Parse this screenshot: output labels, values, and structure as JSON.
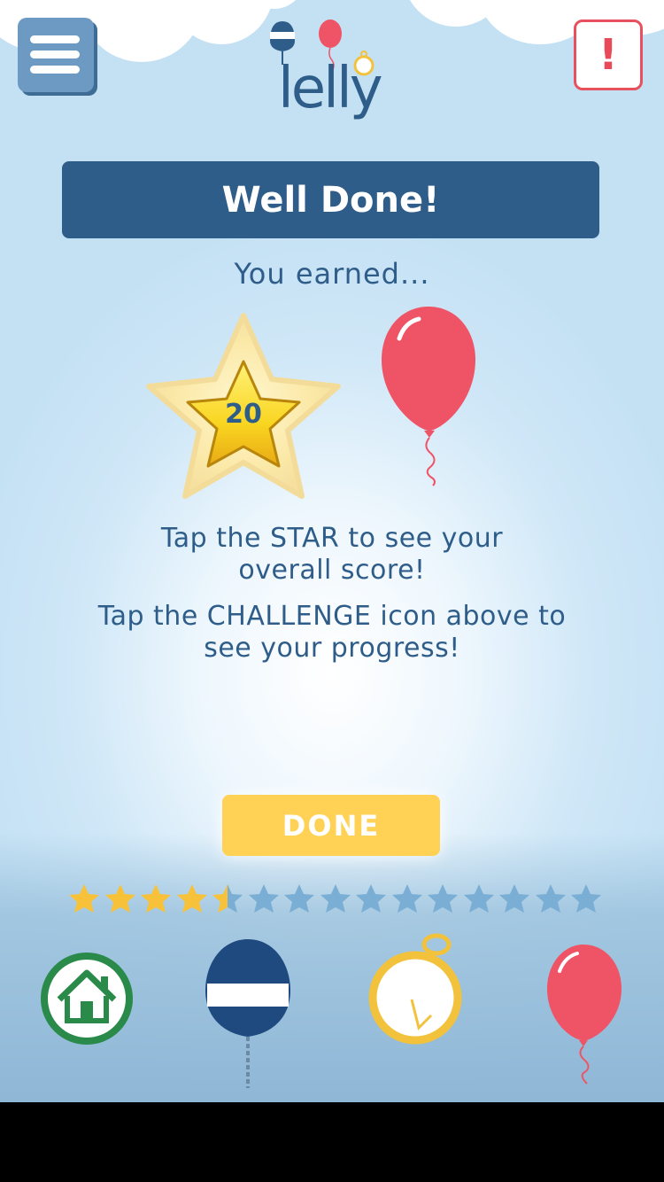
{
  "header": {
    "logo_text": "lelly",
    "menu_icon": "menu-icon",
    "alert_label": "!"
  },
  "banner": {
    "title": "Well Done!"
  },
  "reward": {
    "intro": "You earned...",
    "star_points": "20",
    "balloon_color": "#ef5466"
  },
  "messages": {
    "star_line1": "Tap the STAR to see your",
    "star_line2": "overall score!",
    "challenge_line1": "Tap the CHALLENGE icon above to",
    "challenge_line2": "see your progress!"
  },
  "done_button": {
    "label": "DONE"
  },
  "progress": {
    "total_stars": 15,
    "filled_stars": 4.5,
    "filled_color": "#f7c23a",
    "empty_color": "#7aaed4"
  },
  "bottom_nav": [
    {
      "name": "home",
      "icon": "home-icon"
    },
    {
      "name": "buoy",
      "icon": "buoy-icon"
    },
    {
      "name": "stopwatch",
      "icon": "stopwatch-icon"
    },
    {
      "name": "balloon",
      "icon": "balloon-icon"
    }
  ],
  "colors": {
    "brand_blue": "#2f5d8a",
    "accent_yellow": "#ffd255",
    "alert_red": "#e84a5a",
    "home_green": "#2a8a4a"
  }
}
